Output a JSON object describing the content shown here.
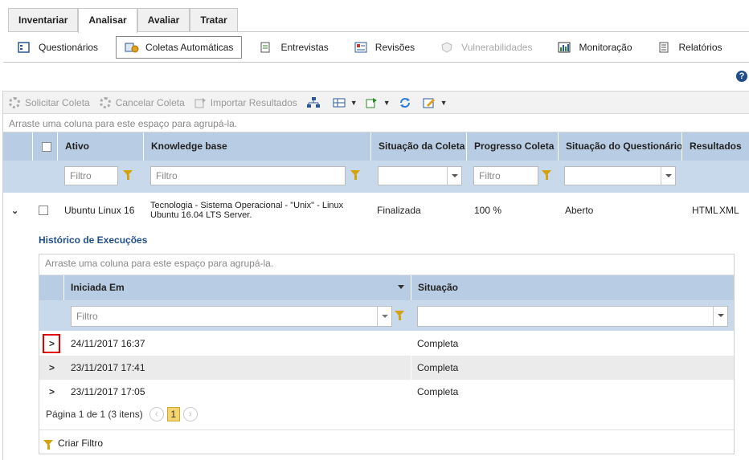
{
  "tabs": [
    "Inventariar",
    "Analisar",
    "Avaliar",
    "Tratar"
  ],
  "subnav": [
    "Questionários",
    "Coletas Automáticas",
    "Entrevistas",
    "Revisões",
    "Vulnerabilidades",
    "Monitoração",
    "Relatórios"
  ],
  "help": "?",
  "toolbar": {
    "solicitar": "Solicitar Coleta",
    "cancelar": "Cancelar Coleta",
    "importar": "Importar Resultados"
  },
  "group_hint": "Arraste uma coluna para este espaço para agrupá-la.",
  "columns": {
    "ativo": "Ativo",
    "kb": "Knowledge base",
    "situacao": "Situação da Coleta",
    "progresso": "Progresso Coleta",
    "questionario": "Situação do Questionário",
    "resultados": "Resultados"
  },
  "filter_placeholder": "Filtro",
  "row": {
    "ativo": "Ubuntu Linux 16",
    "kb_line1": "Tecnologia - Sistema Operacional - \"Unix\" - Linux",
    "kb_line2": "Ubuntu 16.04 LTS Server.",
    "situacao": "Finalizada",
    "progresso": "100 %",
    "questionario": "Aberto",
    "html": "HTML",
    "xml": "XML"
  },
  "inner": {
    "title": "Histórico de Execuções",
    "group_hint": "Arraste uma coluna para este espaço para agrupá-la.",
    "col_iniciada": "Iniciada Em",
    "col_situacao": "Situação",
    "rows": [
      {
        "date": "24/11/2017 16:37",
        "status": "Completa"
      },
      {
        "date": "23/11/2017 17:41",
        "status": "Completa"
      },
      {
        "date": "23/11/2017 17:05",
        "status": "Completa"
      }
    ],
    "pager_text": "Página 1 de 1 (3 itens)",
    "page": "1",
    "prev": "‹",
    "next": "›",
    "criar_filtro": "Criar Filtro"
  }
}
